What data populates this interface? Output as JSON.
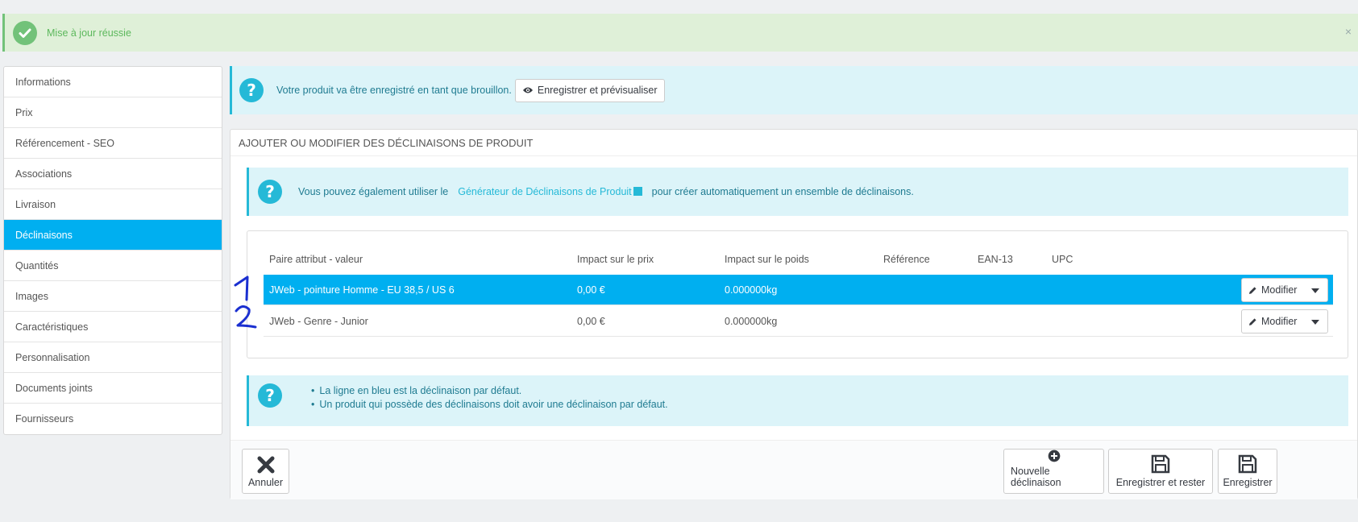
{
  "alert": {
    "message": "Mise à jour réussie",
    "close": "×"
  },
  "sidebar": {
    "items": [
      {
        "label": "Informations"
      },
      {
        "label": "Prix"
      },
      {
        "label": "Référencement - SEO"
      },
      {
        "label": "Associations"
      },
      {
        "label": "Livraison"
      },
      {
        "label": "Déclinaisons",
        "active": true
      },
      {
        "label": "Quantités"
      },
      {
        "label": "Images"
      },
      {
        "label": "Caractéristiques"
      },
      {
        "label": "Personnalisation"
      },
      {
        "label": "Documents joints"
      },
      {
        "label": "Fournisseurs"
      }
    ]
  },
  "draft_info": {
    "icon": "?",
    "text": "Votre produit va être enregistré en tant que brouillon.",
    "button": "Enregistrer et prévisualiser"
  },
  "panel": {
    "heading": "AJOUTER OU MODIFIER DES DÉCLINAISONS DE PRODUIT",
    "generator_info": {
      "text_before": "Vous pouvez également utiliser le",
      "link": "Générateur de Déclinaisons de Produit",
      "text_after": "pour créer automatiquement un ensemble de déclinaisons."
    },
    "table": {
      "headers": [
        "Paire attribut - valeur",
        "Impact sur le prix",
        "Impact sur le poids",
        "Référence",
        "EAN-13",
        "UPC"
      ],
      "rows": [
        {
          "attribute": "JWeb - pointure Homme - EU 38,5 / US 6",
          "price": "0,00 €",
          "weight": "0.000000kg",
          "reference": "",
          "ean13": "",
          "upc": "",
          "action": "Modifier",
          "default": true
        },
        {
          "attribute": "JWeb - Genre - Junior",
          "price": "0,00 €",
          "weight": "0.000000kg",
          "reference": "",
          "ean13": "",
          "upc": "",
          "action": "Modifier",
          "default": false
        }
      ]
    },
    "default_info": {
      "items": [
        "La ligne en bleu est la déclinaison par défaut.",
        "Un produit qui possède des déclinaisons doit avoir une déclinaison par défaut."
      ]
    },
    "footer": {
      "cancel": "Annuler",
      "new": "Nouvelle déclinaison",
      "save_stay": "Enregistrer et rester",
      "save": "Enregistrer"
    }
  },
  "annotations": {
    "one": "1",
    "two": "2"
  },
  "colors": {
    "accent": "#00aff0",
    "info": "#25b9d7",
    "success": "#72c279"
  }
}
